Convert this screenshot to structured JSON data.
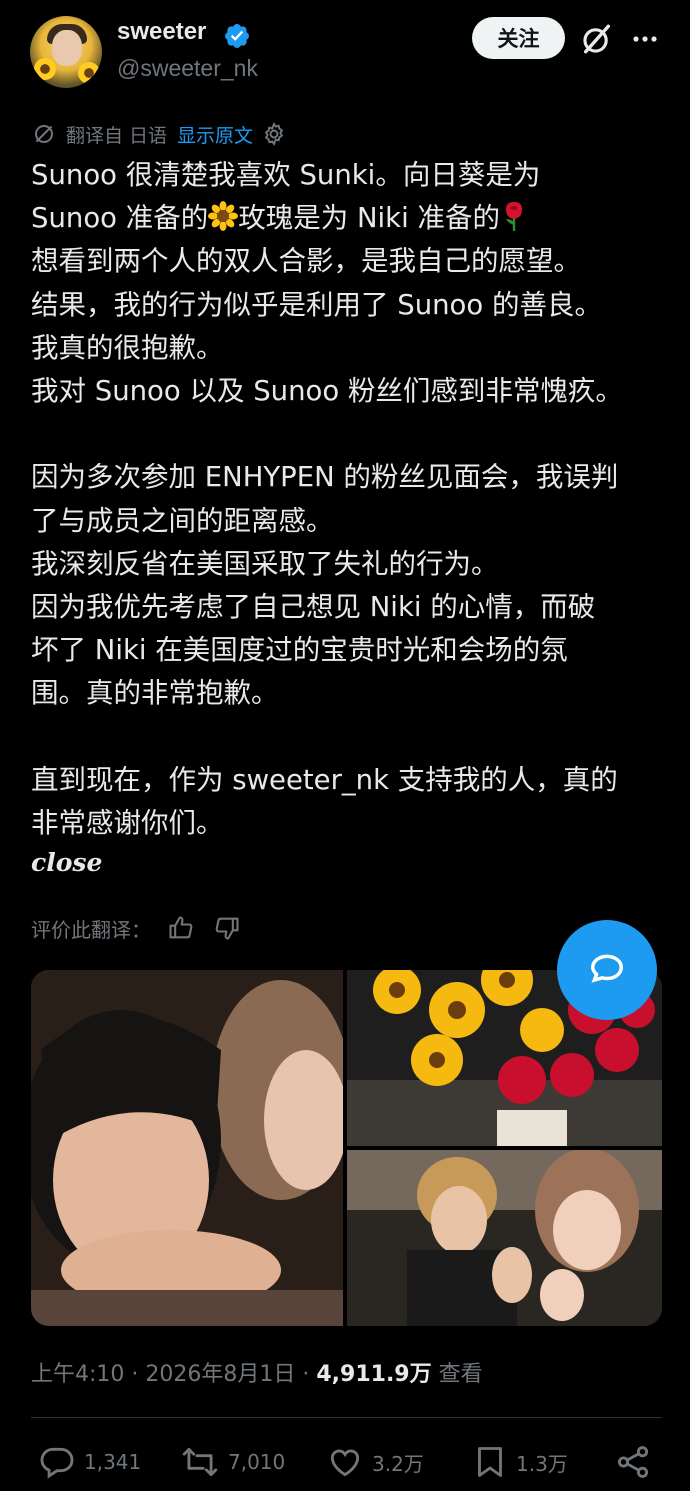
{
  "user": {
    "display_name": "sweeter",
    "handle": "@sweeter_nk",
    "follow_label": "关注"
  },
  "translation": {
    "source_label": "翻译自 日语",
    "show_original_label": "显示原文"
  },
  "tweet": {
    "lines": [
      "Sunoo 很清楚我喜欢 Sunki。向日葵是为",
      "Sunoo 准备的",
      "玫瑰是为 Niki 准备的",
      "想看到两个人的双人合影，是我自己的愿望。",
      "结果，我的行为似乎是利用了 Sunoo 的善良。",
      "我真的很抱歉。",
      "我对 Sunoo 以及 Sunoo 粉丝们感到非常愧疚。",
      "因为多次参加 ENHYPEN 的粉丝见面会，我误判",
      "了与成员之间的距离感。",
      "我深刻反省在美国采取了失礼的行为。",
      "因为我优先考虑了自己想见 Niki 的心情，而破",
      "坏了 Niki 在美国度过的宝贵时光和会场的氛",
      "围。真的非常抱歉。",
      "直到现在，作为 sweeter_nk 支持我的人，真的",
      "非常感谢你们。"
    ],
    "close_word": "close"
  },
  "rate_translation": {
    "label": "评价此翻译："
  },
  "meta": {
    "time": "上午4:10 · 2026年8月1日 · ",
    "views_count": "4,911.9万",
    "views_label": " 查看"
  },
  "actions": {
    "replies": "1,341",
    "reposts": "7,010",
    "likes": "3.2万",
    "bookmarks": "1.3万"
  },
  "colors": {
    "background": "#000000",
    "text": "#e7e9ea",
    "muted": "#71767b",
    "accent": "#1d9bf0"
  }
}
